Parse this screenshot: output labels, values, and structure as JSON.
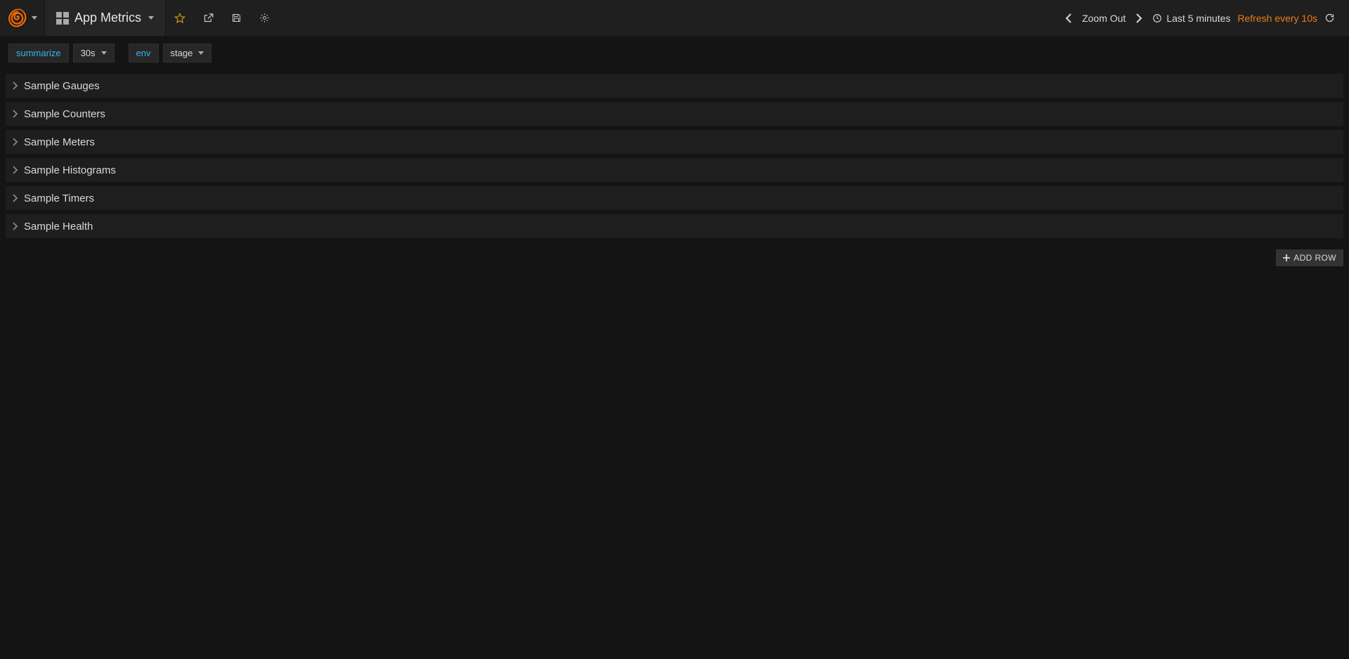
{
  "header": {
    "dashboard_title": "App Metrics",
    "zoom_out": "Zoom Out",
    "time_range": "Last 5 minutes",
    "refresh_label": "Refresh every 10s"
  },
  "variables": {
    "summarize_label": "summarize",
    "summarize_value": "30s",
    "env_label": "env",
    "env_value": "stage"
  },
  "rows": [
    {
      "title": "Sample Gauges"
    },
    {
      "title": "Sample Counters"
    },
    {
      "title": "Sample Meters"
    },
    {
      "title": "Sample Histograms"
    },
    {
      "title": "Sample Timers"
    },
    {
      "title": "Sample Health"
    }
  ],
  "add_row_label": "ADD ROW"
}
